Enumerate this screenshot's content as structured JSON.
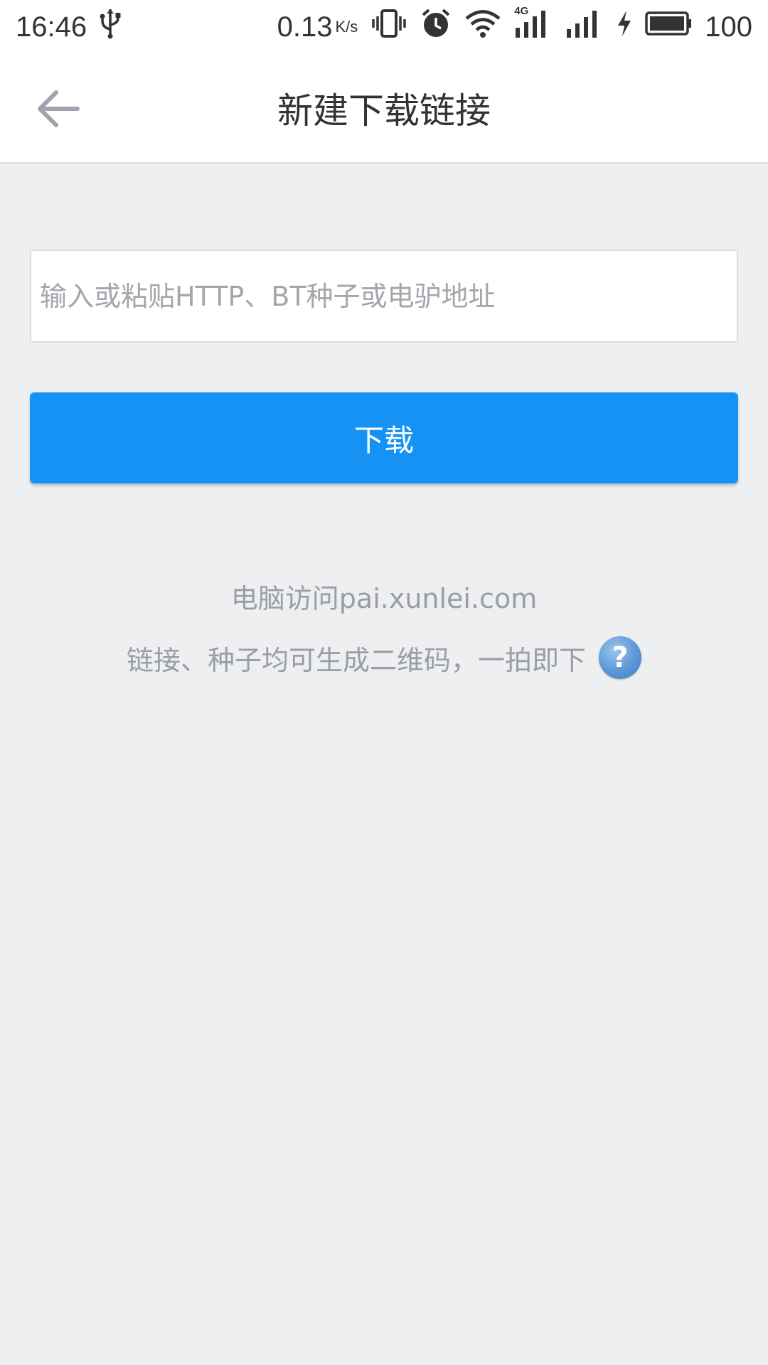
{
  "status_bar": {
    "time": "16:46",
    "network_speed": "0.13",
    "network_speed_unit": "K/s",
    "network_type": "4G",
    "battery_level": "100",
    "icons": [
      "usb-icon",
      "vibrate-icon",
      "alarm-icon",
      "wifi-icon",
      "signal-icon",
      "signal-icon",
      "charging-icon",
      "battery-icon"
    ]
  },
  "header": {
    "title": "新建下载链接",
    "back_icon": "arrow-left-icon"
  },
  "link_input": {
    "value": "",
    "placeholder": "输入或粘贴HTTP、BT种子或电驴地址"
  },
  "download_button": {
    "label": "下载"
  },
  "tips": {
    "line1": "电脑访问pai.xunlei.com",
    "line2": "链接、种子均可生成二维码，一拍即下",
    "help_icon_glyph": "?"
  },
  "colors": {
    "accent": "#1592f3",
    "background": "#edeff0",
    "hint_text": "#9a9ea4"
  }
}
